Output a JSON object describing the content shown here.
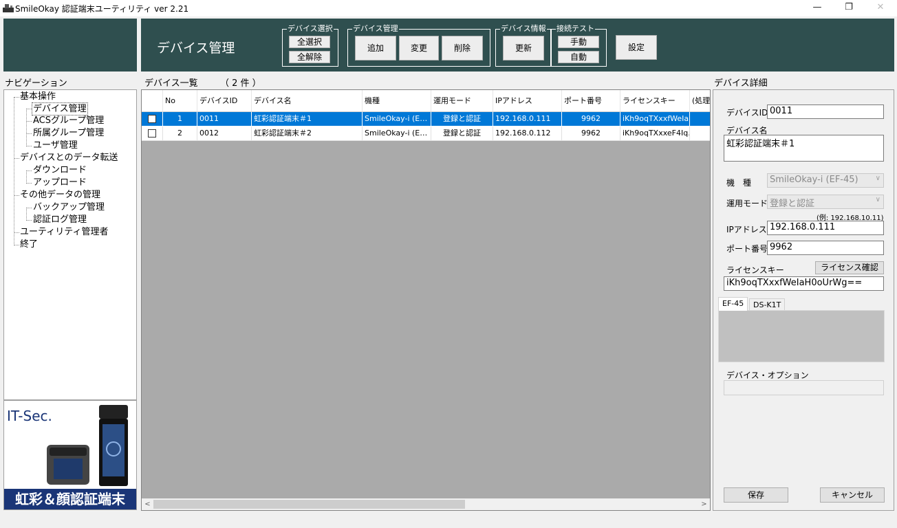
{
  "window": {
    "title": "SmileOkay 認証端末ユーティリティ ver 2.21",
    "minimize": "—",
    "maximize": "❐",
    "close": "✕"
  },
  "header": {
    "page_title": "デバイス管理",
    "groups": {
      "select": {
        "title": "デバイス選択",
        "select_all": "全選択",
        "deselect_all": "全解除"
      },
      "manage": {
        "title": "デバイス管理",
        "add": "追加",
        "edit": "変更",
        "delete": "削除"
      },
      "info": {
        "title": "デバイス情報",
        "refresh": "更新"
      },
      "test": {
        "title": "接続テスト",
        "manual": "手動",
        "auto": "自動"
      }
    },
    "settings": "設定"
  },
  "navigation": {
    "label": "ナビゲーション",
    "tree": [
      {
        "label": "基本操作",
        "children": [
          "デバイス管理",
          "ACSグループ管理",
          "所属グループ管理",
          "ユーザ管理"
        ]
      },
      {
        "label": "デバイスとのデータ転送",
        "children": [
          "ダウンロード",
          "アップロード"
        ]
      },
      {
        "label": "その他データの管理",
        "children": [
          "バックアップ管理",
          "認証ログ管理"
        ]
      },
      {
        "label": "ユーティリティ管理者",
        "children": []
      },
      {
        "label": "終了",
        "children": []
      }
    ],
    "selected": "デバイス管理"
  },
  "ad": {
    "logo": "IT-Sec.",
    "banner": "虹彩＆顔認証端末"
  },
  "device_list": {
    "label": "デバイス一覧",
    "count": "（ 2 件 ）",
    "columns": [
      "No",
      "デバイスID",
      "デバイス名",
      "機種",
      "運用モード",
      "IPアドレス",
      "ポート番号",
      "ライセンスキー",
      "(処理"
    ],
    "rows": [
      {
        "no": "1",
        "id": "0011",
        "name": "虹彩認証端末＃1",
        "model": "SmileOkay-i (E…",
        "mode": "登録と認証",
        "ip": "192.168.0.111",
        "port": "9962",
        "license": "iKh9oqTXxxfWeIa…",
        "selected": true
      },
      {
        "no": "2",
        "id": "0012",
        "name": "虹彩認証端末＃2",
        "model": "SmileOkay-i (E…",
        "mode": "登録と認証",
        "ip": "192.168.0.112",
        "port": "9962",
        "license": "iKh9oqTXxxeF4Iq…",
        "selected": false
      }
    ],
    "scroll_left": "<",
    "scroll_right": ">"
  },
  "detail": {
    "label": "デバイス詳細",
    "device_id_label": "デバイスID",
    "device_id": "0011",
    "device_name_label": "デバイス名",
    "device_name": "虹彩認証端末＃1",
    "model_label": "機　種",
    "model": "SmileOkay-i (EF-45)",
    "mode_label": "運用モード",
    "mode": "登録と認証",
    "ip_hint": "(例: 192.168.10.11)",
    "ip_label": "IPアドレス",
    "ip": "192.168.0.111",
    "port_label": "ポート番号",
    "port": "9962",
    "license_label": "ライセンスキー",
    "license_check": "ライセンス確認",
    "license": "iKh9oqTXxxfWeIaH0oUrWg==",
    "tabs": [
      "EF-45",
      "DS-K1T"
    ],
    "options_label": "デバイス・オプション",
    "save": "保存",
    "cancel": "キャンセル"
  }
}
